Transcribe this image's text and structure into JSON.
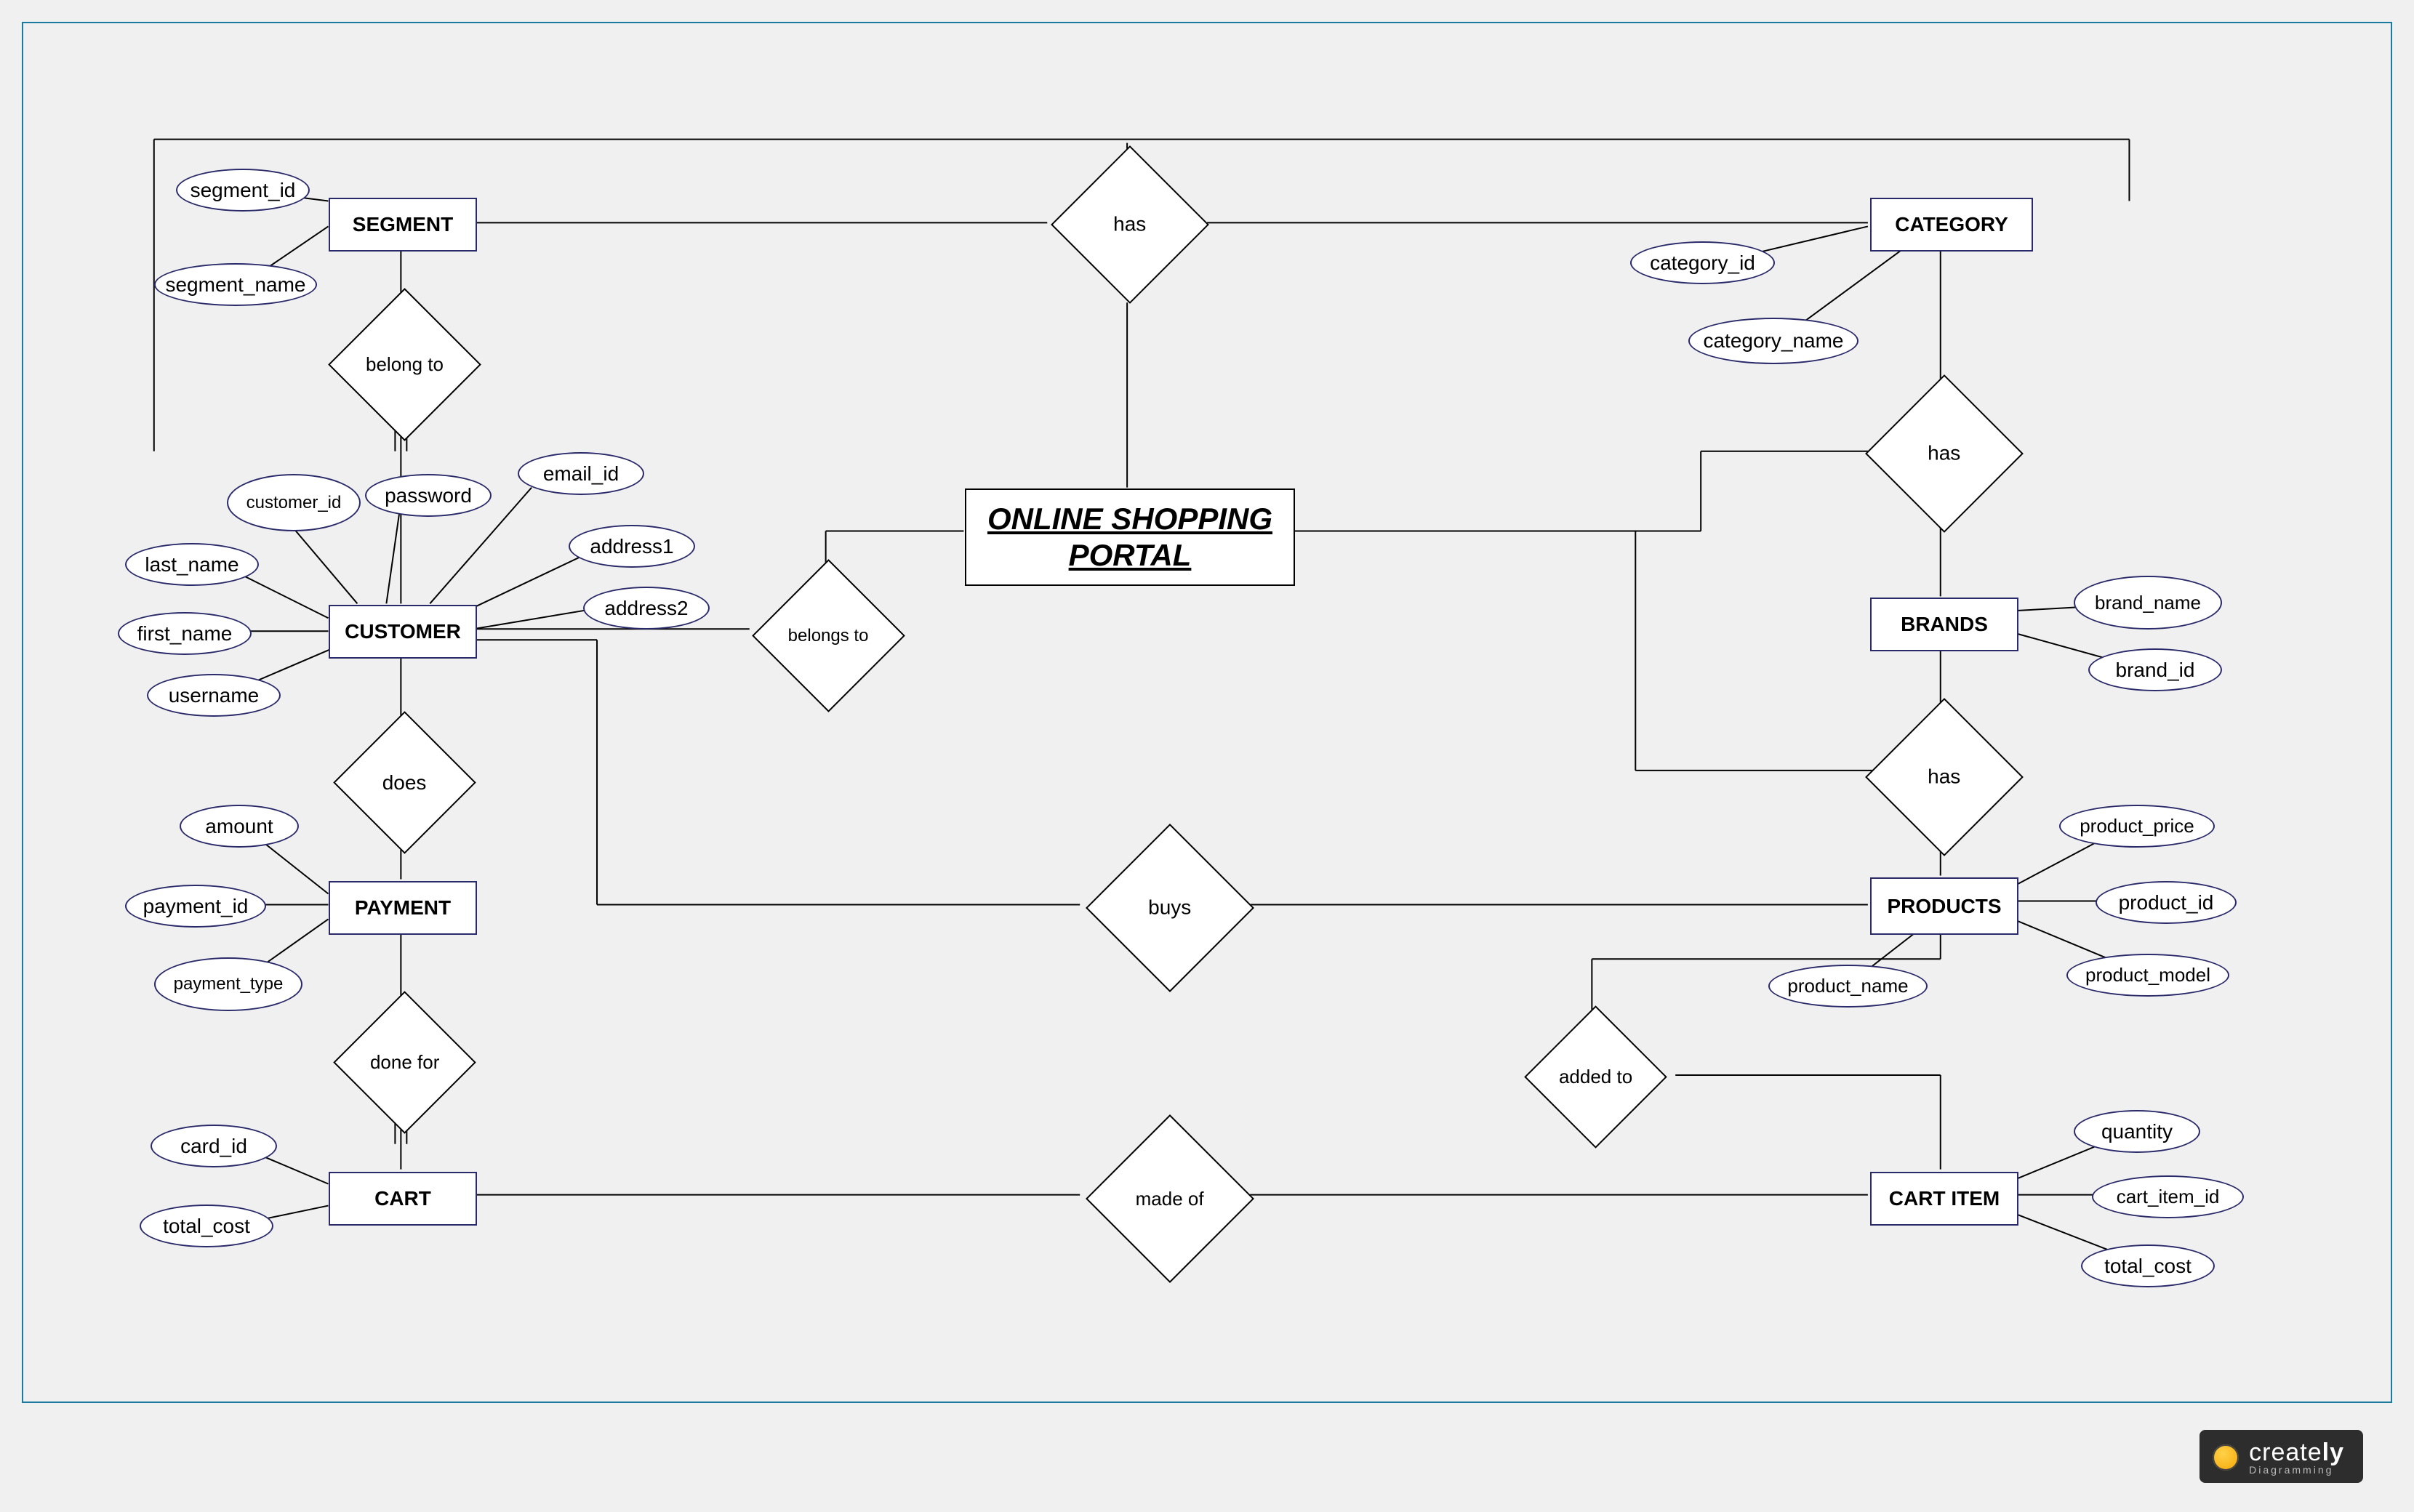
{
  "title": "ONLINE SHOPPING PORTAL",
  "entities": {
    "segment": "SEGMENT",
    "category": "CATEGORY",
    "customer": "CUSTOMER",
    "brands": "BRANDS",
    "payment": "PAYMENT",
    "products": "PRODUCTS",
    "cart": "CART",
    "cart_item": "CART ITEM"
  },
  "relationships": {
    "has_top": "has",
    "belong_to": "belong to",
    "has_cat_brand": "has",
    "belongs_to": "belongs to",
    "does": "does",
    "has_brand_prod": "has",
    "buys": "buys",
    "done_for": "done for",
    "added_to": "added to",
    "made_of": "made of"
  },
  "attributes": {
    "segment_id": "segment_id",
    "segment_name": "segment_name",
    "category_id": "category_id",
    "category_name": "category_name",
    "customer_id": "customer_id",
    "password": "password",
    "email_id": "email_id",
    "address1": "address1",
    "address2": "address2",
    "last_name": "last_name",
    "first_name": "first_name",
    "username": "username",
    "brand_name": "brand_name",
    "brand_id": "brand_id",
    "amount": "amount",
    "payment_id": "payment_id",
    "payment_type": "payment_type",
    "product_price": "product_price",
    "product_id": "product_id",
    "product_model": "product_model",
    "product_name": "product_name",
    "card_id": "card_id",
    "total_cost_cart": "total_cost",
    "quantity": "quantity",
    "cart_item_id": "cart_item_id",
    "total_cost_item": "total_cost"
  },
  "branding": {
    "name_a": "create",
    "name_b": "ly",
    "tagline": "Diagramming"
  }
}
